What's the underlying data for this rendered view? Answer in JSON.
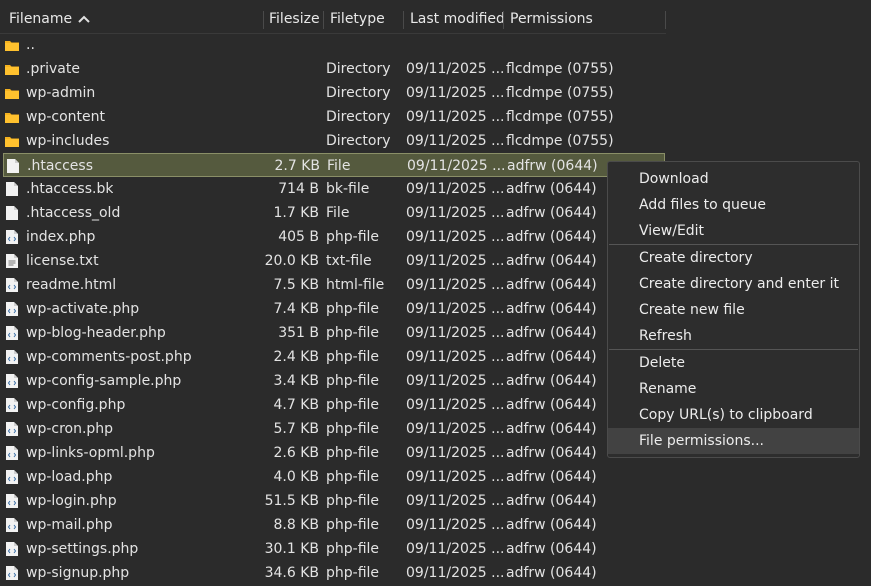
{
  "columns": {
    "filename": "Filename",
    "filesize": "Filesize",
    "filetype": "Filetype",
    "modified": "Last modified",
    "permissions": "Permissions"
  },
  "files": [
    {
      "name": "..",
      "size": "",
      "type": "",
      "modified": "",
      "perm": "",
      "icon": "folder-icon"
    },
    {
      "name": ".private",
      "size": "",
      "type": "Directory",
      "modified": "09/11/2025 ...",
      "perm": "flcdmpe (0755)",
      "icon": "folder-icon"
    },
    {
      "name": "wp-admin",
      "size": "",
      "type": "Directory",
      "modified": "09/11/2025 ...",
      "perm": "flcdmpe (0755)",
      "icon": "folder-icon"
    },
    {
      "name": "wp-content",
      "size": "",
      "type": "Directory",
      "modified": "09/11/2025 ...",
      "perm": "flcdmpe (0755)",
      "icon": "folder-icon"
    },
    {
      "name": "wp-includes",
      "size": "",
      "type": "Directory",
      "modified": "09/11/2025 ...",
      "perm": "flcdmpe (0755)",
      "icon": "folder-icon"
    },
    {
      "name": ".htaccess",
      "size": "2.7 KB",
      "type": "File",
      "modified": "09/11/2025 ...",
      "perm": "adfrw (0644)",
      "icon": "file-icon",
      "selected": true
    },
    {
      "name": ".htaccess.bk",
      "size": "714 B",
      "type": "bk-file",
      "modified": "09/11/2025 ...",
      "perm": "adfrw (0644)",
      "icon": "file-icon"
    },
    {
      "name": ".htaccess_old",
      "size": "1.7 KB",
      "type": "File",
      "modified": "09/11/2025 ...",
      "perm": "adfrw (0644)",
      "icon": "file-icon"
    },
    {
      "name": "index.php",
      "size": "405 B",
      "type": "php-file",
      "modified": "09/11/2025 ...",
      "perm": "adfrw (0644)",
      "icon": "code-file-icon"
    },
    {
      "name": "license.txt",
      "size": "20.0 KB",
      "type": "txt-file",
      "modified": "09/11/2025 ...",
      "perm": "adfrw (0644)",
      "icon": "text-file-icon"
    },
    {
      "name": "readme.html",
      "size": "7.5 KB",
      "type": "html-file",
      "modified": "09/11/2025 ...",
      "perm": "adfrw (0644)",
      "icon": "code-file-icon"
    },
    {
      "name": "wp-activate.php",
      "size": "7.4 KB",
      "type": "php-file",
      "modified": "09/11/2025 ...",
      "perm": "adfrw (0644)",
      "icon": "code-file-icon"
    },
    {
      "name": "wp-blog-header.php",
      "size": "351 B",
      "type": "php-file",
      "modified": "09/11/2025 ...",
      "perm": "adfrw (0644)",
      "icon": "code-file-icon"
    },
    {
      "name": "wp-comments-post.php",
      "size": "2.4 KB",
      "type": "php-file",
      "modified": "09/11/2025 ...",
      "perm": "adfrw (0644)",
      "icon": "code-file-icon"
    },
    {
      "name": "wp-config-sample.php",
      "size": "3.4 KB",
      "type": "php-file",
      "modified": "09/11/2025 ...",
      "perm": "adfrw (0644)",
      "icon": "code-file-icon"
    },
    {
      "name": "wp-config.php",
      "size": "4.7 KB",
      "type": "php-file",
      "modified": "09/11/2025 ...",
      "perm": "adfrw (0644)",
      "icon": "code-file-icon"
    },
    {
      "name": "wp-cron.php",
      "size": "5.7 KB",
      "type": "php-file",
      "modified": "09/11/2025 ...",
      "perm": "adfrw (0644)",
      "icon": "code-file-icon"
    },
    {
      "name": "wp-links-opml.php",
      "size": "2.6 KB",
      "type": "php-file",
      "modified": "09/11/2025 ...",
      "perm": "adfrw (0644)",
      "icon": "code-file-icon"
    },
    {
      "name": "wp-load.php",
      "size": "4.0 KB",
      "type": "php-file",
      "modified": "09/11/2025 ...",
      "perm": "adfrw (0644)",
      "icon": "code-file-icon"
    },
    {
      "name": "wp-login.php",
      "size": "51.5 KB",
      "type": "php-file",
      "modified": "09/11/2025 ...",
      "perm": "adfrw (0644)",
      "icon": "code-file-icon"
    },
    {
      "name": "wp-mail.php",
      "size": "8.8 KB",
      "type": "php-file",
      "modified": "09/11/2025 ...",
      "perm": "adfrw (0644)",
      "icon": "code-file-icon"
    },
    {
      "name": "wp-settings.php",
      "size": "30.1 KB",
      "type": "php-file",
      "modified": "09/11/2025 ...",
      "perm": "adfrw (0644)",
      "icon": "code-file-icon"
    },
    {
      "name": "wp-signup.php",
      "size": "34.6 KB",
      "type": "php-file",
      "modified": "09/11/2025 ...",
      "perm": "adfrw (0644)",
      "icon": "code-file-icon"
    }
  ],
  "context_menu": {
    "groups": [
      [
        "Download",
        "Add files to queue",
        "View/Edit"
      ],
      [
        "Create directory",
        "Create directory and enter it",
        "Create new file",
        "Refresh"
      ],
      [
        "Delete",
        "Rename",
        "Copy URL(s) to clipboard",
        "File permissions..."
      ]
    ],
    "highlighted": "File permissions..."
  },
  "colors": {
    "background": "#2b2b2b",
    "selected_row": "#555a3e",
    "folder": "#f5b21f",
    "menu_bg": "#2d2d2d"
  }
}
